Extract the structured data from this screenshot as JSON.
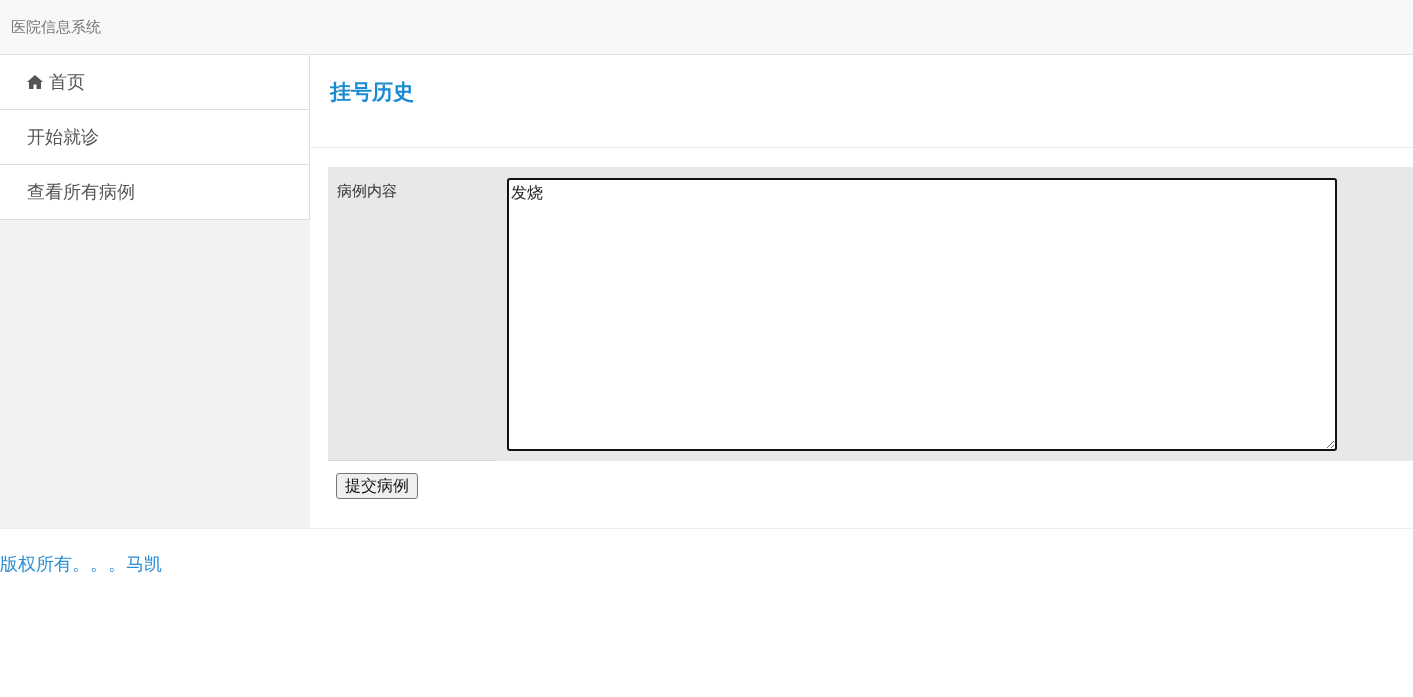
{
  "navbar": {
    "brand": "医院信息系统"
  },
  "sidebar": {
    "items": [
      {
        "label": "首页",
        "kind": "icon"
      },
      {
        "label": "开始就诊",
        "kind": "plain"
      },
      {
        "label": "查看所有病例",
        "kind": "plain"
      }
    ]
  },
  "page": {
    "title": "挂号历史"
  },
  "form": {
    "fields": [
      {
        "label": "病例内容",
        "value": "发烧",
        "focused": true
      }
    ],
    "submit": "提交病例"
  },
  "footer": {
    "text": "版权所有。。。马凯"
  }
}
